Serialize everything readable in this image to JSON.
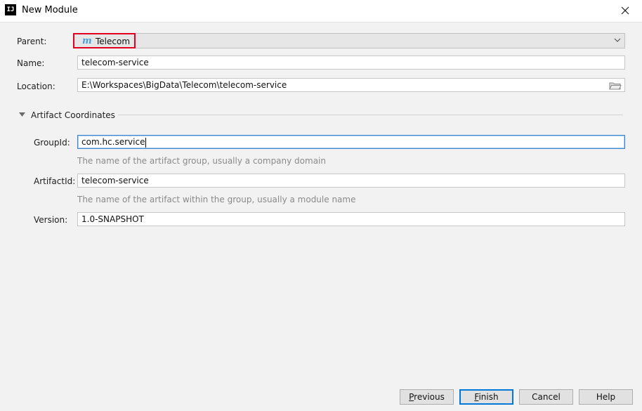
{
  "window": {
    "title": "New Module",
    "app_icon_text": "IJ"
  },
  "form": {
    "parent_label": "Parent:",
    "parent_value": "Telecom",
    "parent_icon": "m",
    "name_label": "Name:",
    "name_value": "telecom-service",
    "location_label": "Location:",
    "location_value": "E:\\Workspaces\\BigData\\Telecom\\telecom-service"
  },
  "artifact": {
    "section_title": "Artifact Coordinates",
    "groupid_label": "GroupId:",
    "groupid_value": "com.hc.service",
    "groupid_hint": "The name of the artifact group, usually a company domain",
    "artifactid_label": "ArtifactId:",
    "artifactid_value": "telecom-service",
    "artifactid_hint": "The name of the artifact within the group, usually a module name",
    "version_label": "Version:",
    "version_value": "1.0-SNAPSHOT"
  },
  "buttons": {
    "previous_mnemonic": "P",
    "previous_rest": "revious",
    "finish_mnemonic": "F",
    "finish_rest": "inish",
    "cancel": "Cancel",
    "help": "Help"
  },
  "colors": {
    "highlight": "#e1001f",
    "focus": "#3d87cf",
    "maven_icon": "#4a9fd8"
  }
}
